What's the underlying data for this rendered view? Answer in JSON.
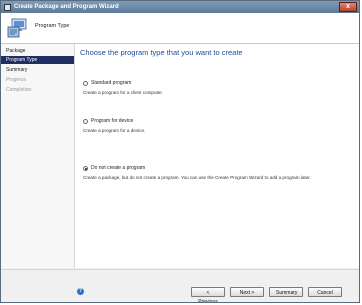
{
  "window": {
    "title": "Create Package and Program Wizard",
    "close_glyph": "x"
  },
  "header": {
    "title": "Program Type"
  },
  "sidebar": {
    "items": [
      {
        "label": "Package",
        "state": "normal"
      },
      {
        "label": "Program Type",
        "state": "selected"
      },
      {
        "label": "Summary",
        "state": "normal"
      },
      {
        "label": "Progress",
        "state": "disabled"
      },
      {
        "label": "Completion",
        "state": "disabled"
      }
    ]
  },
  "main": {
    "heading": "Choose the program type that you want to create",
    "options": [
      {
        "label": "Standard program",
        "description": "Create a program for a client computer.",
        "checked": false
      },
      {
        "label": "Program for device",
        "description": "Create a program for a device.",
        "checked": false
      },
      {
        "label": "Do not create a program",
        "description": "Create a package, but do not create a program. You can use the Create Program Wizard to add a program later.",
        "checked": true
      }
    ]
  },
  "footer": {
    "help_glyph": "?",
    "previous_label": "< Previous",
    "next_label": "Next >",
    "summary_label": "Summary",
    "cancel_label": "Cancel"
  }
}
